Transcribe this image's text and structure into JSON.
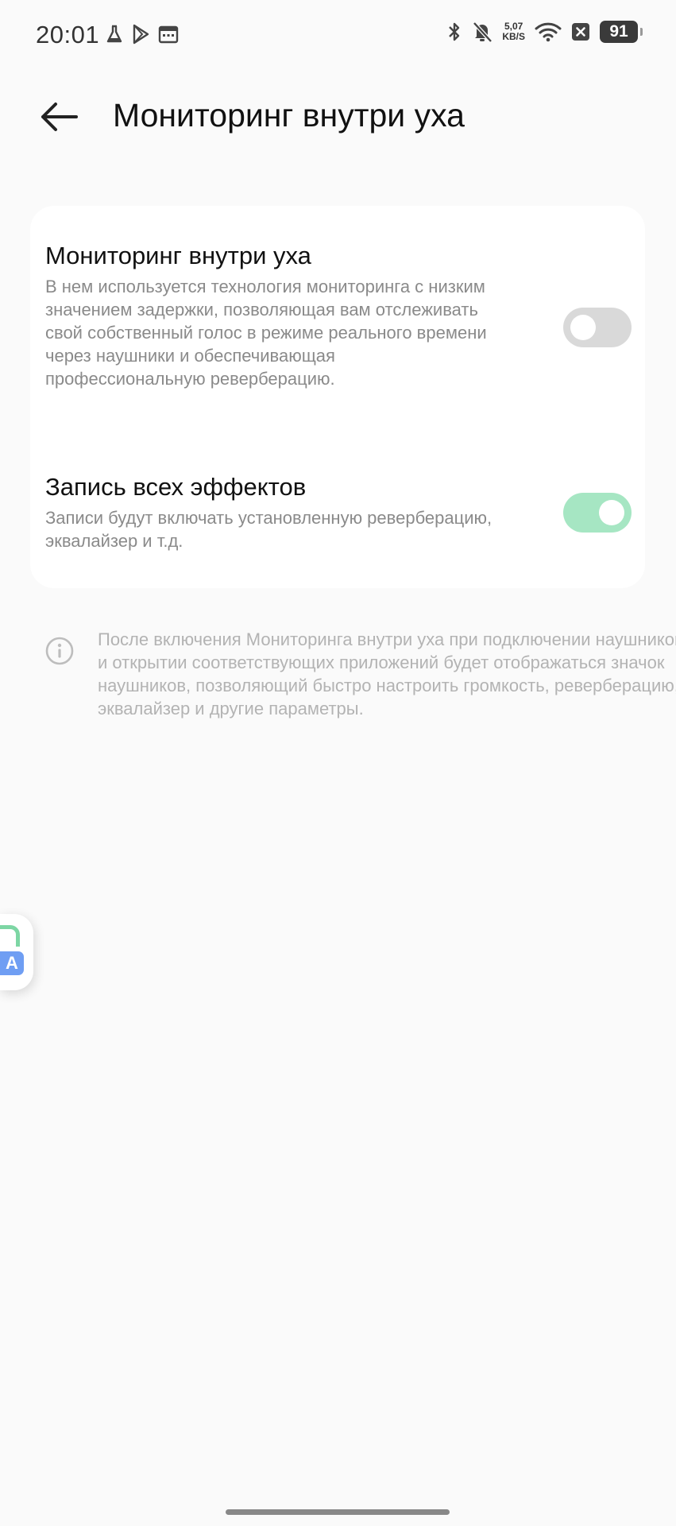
{
  "status_bar": {
    "time": "20:01",
    "net_speed_value": "5,07",
    "net_speed_unit": "KB/S",
    "battery": "91",
    "icons": [
      "flask-icon",
      "play-store-icon",
      "calendar-icon",
      "bluetooth-icon",
      "bell-off-icon",
      "wifi-icon",
      "close-box-icon"
    ]
  },
  "header": {
    "title": "Мониторинг внутри уха"
  },
  "settings": {
    "items": [
      {
        "title": "Мониторинг внутри уха",
        "description": "В нем используется технология мониторинга с низким значением задержки, позволяющая вам отслеживать свой собственный голос в режиме реального времени через наушники и обеспечивающая профессиональную реверберацию.",
        "enabled": false
      },
      {
        "title": "Запись всех эффектов",
        "description": "Записи будут включать установленную реверберацию, эквалайзер и т.д.",
        "enabled": true
      }
    ]
  },
  "info_note": "После включения Мониторинга внутри уха при подключении наушников и открытии соответствующих приложений будет отображаться значок наушников, позволяющий быстро настроить громкость, реверберацию, эквалайзер и другие параметры.",
  "side_widget": {
    "label": "A"
  },
  "colors": {
    "background": "#fafafa",
    "card": "#ffffff",
    "toggle_on": "#a6e6c3",
    "toggle_off": "#d9d9d9",
    "secondary_text": "#8a8a8a"
  }
}
